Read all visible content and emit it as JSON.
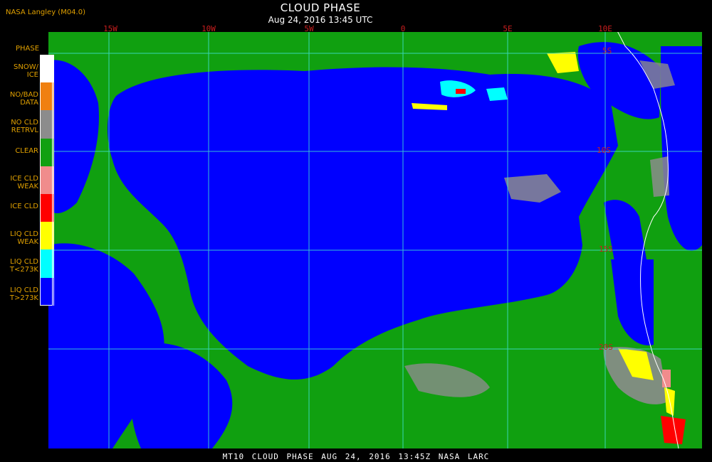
{
  "credit": "NASA Langley (M04.0)",
  "title": "CLOUD PHASE",
  "subtitle": "Aug 24, 2016 13:45 UTC",
  "footer": "MT10  CLOUD PHASE  AUG 24, 2016 13:45Z  NASA LARC",
  "legend": {
    "title": "PHASE",
    "items": [
      {
        "label": "SNOW/ ICE",
        "color": "#ffffff"
      },
      {
        "label": "NO/BAD DATA",
        "color": "#f08010"
      },
      {
        "label": "NO CLD RETRVL",
        "color": "#8c8c8c"
      },
      {
        "label": "CLEAR",
        "color": "#10a010"
      },
      {
        "label": "ICE CLD WEAK",
        "color": "#f08c8c"
      },
      {
        "label": "ICE CLD",
        "color": "#ff0000"
      },
      {
        "label": "LIQ CLD WEAK",
        "color": "#ffff00"
      },
      {
        "label": "LIQ CLD T<273K",
        "color": "#00ffff"
      },
      {
        "label": "LIQ CLD T>273K",
        "color": "#0000ff"
      }
    ]
  },
  "grid": {
    "color": "#40e0d0",
    "label_color": "#c81e1e",
    "longitudes": [
      "15W",
      "10W",
      "5W",
      "0",
      "5E",
      "10E"
    ],
    "latitudes": [
      "5S",
      "10S",
      "15S",
      "20S"
    ]
  },
  "coast_color": "#ffffff"
}
